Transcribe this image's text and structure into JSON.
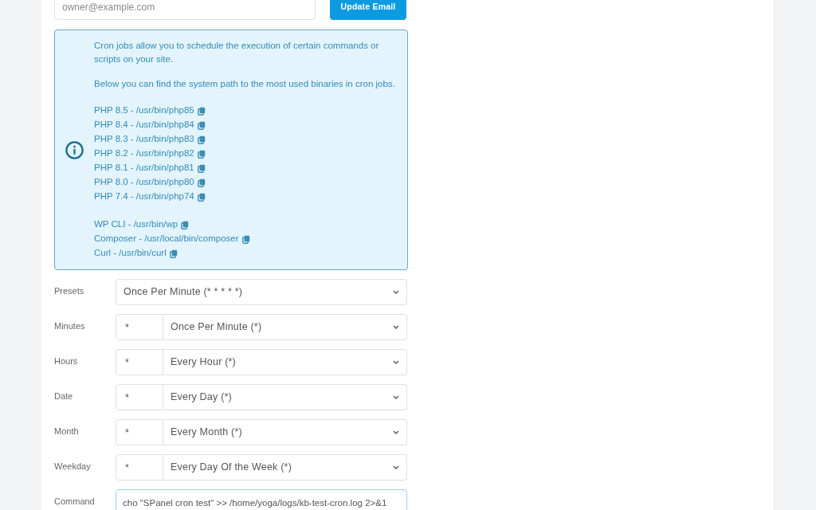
{
  "email_form": {
    "email": {
      "placeholder": "owner@example.com"
    },
    "button": "Update Email"
  },
  "info_box": {
    "paragraphs": [
      "Cron jobs allow you to schedule the execution of certain commands or scripts on your site.",
      "Below you can find the system path to the most used binaries in cron jobs."
    ],
    "binary_groups": [
      {
        "items": [
          "PHP 8.5 - /usr/bin/php85",
          "PHP 8.4 - /usr/bin/php84",
          "PHP 8.3 - /usr/bin/php83",
          "PHP 8.2 - /usr/bin/php82",
          "PHP 8.1 - /usr/bin/php81",
          "PHP 8.0 - /usr/bin/php80",
          "PHP 7.4 - /usr/bin/php74"
        ]
      },
      {
        "items": [
          "WP CLI - /usr/bin/wp",
          "Composer - /usr/local/bin/composer",
          "Curl - /usr/bin/curl"
        ]
      }
    ]
  },
  "schedule_form": {
    "rows": [
      {
        "label": "Presets",
        "kind": "select",
        "selected_option": "Once Per Minute (* * * * *)"
      },
      {
        "label": "Minutes",
        "kind": "combo",
        "value": "*",
        "selected_option": "Once Per Minute (*)"
      },
      {
        "label": "Hours",
        "kind": "combo",
        "value": "*",
        "selected_option": "Every Hour (*)"
      },
      {
        "label": "Date",
        "kind": "combo",
        "value": "*",
        "selected_option": "Every Day (*)"
      },
      {
        "label": "Month",
        "kind": "combo",
        "value": "*",
        "selected_option": "Every Month (*)"
      },
      {
        "label": "Weekday",
        "kind": "combo",
        "value": "*",
        "selected_option": "Every Day Of the Week (*)"
      },
      {
        "label": "Command",
        "kind": "text",
        "value": "cho \"SPanel cron test\" >> /home/yoga/logs/kb-test-cron.log 2>&1",
        "focused": true
      }
    ]
  }
}
